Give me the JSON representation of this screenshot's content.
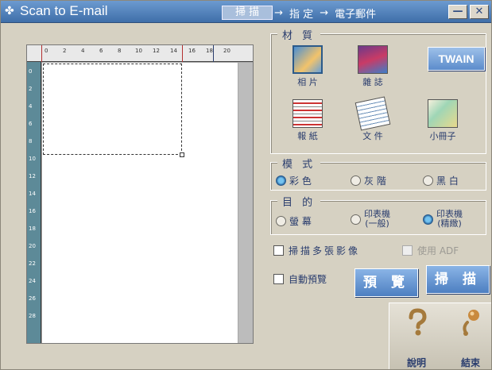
{
  "window": {
    "title": "Scan to E-mail",
    "icon": "scanner-icon"
  },
  "steps": {
    "step1": "掃 描",
    "step2": "指 定",
    "step3": "電子郵件",
    "arrow": "→"
  },
  "title_buttons": {
    "minimize": "—",
    "close": "✕"
  },
  "ruler": {
    "top_ticks": [
      "0",
      "2",
      "4",
      "6",
      "8",
      "10",
      "12",
      "14",
      "16",
      "18",
      "20"
    ],
    "left_ticks": [
      "0",
      "2",
      "4",
      "6",
      "8",
      "10",
      "12",
      "14",
      "16",
      "18",
      "20",
      "22",
      "24",
      "26",
      "28"
    ]
  },
  "material": {
    "title": "材 質",
    "items": [
      {
        "label": "相 片",
        "selected": true,
        "icon": "photo-icon"
      },
      {
        "label": "雜 誌",
        "selected": false,
        "icon": "magazine-icon"
      },
      {
        "label": "報 紙",
        "selected": false,
        "icon": "newspaper-icon"
      },
      {
        "label": "文 件",
        "selected": false,
        "icon": "document-icon"
      },
      {
        "label": "小冊子",
        "selected": false,
        "icon": "booklet-icon"
      }
    ]
  },
  "twain_label": "TWAIN",
  "mode": {
    "title": "模 式",
    "options": [
      {
        "label": "彩 色",
        "selected": true
      },
      {
        "label": "灰 階",
        "selected": false
      },
      {
        "label": "黑 白",
        "selected": false
      }
    ]
  },
  "purpose": {
    "title": "目 的",
    "options": [
      {
        "label": "螢 幕",
        "selected": false
      },
      {
        "label_line1": "印表機",
        "label_line2": "(一般)",
        "selected": false
      },
      {
        "label_line1": "印表機",
        "label_line2": "(精緻)",
        "selected": true
      }
    ]
  },
  "checks": {
    "multi_scan": "掃描多張影像",
    "adf": "使用 ADF",
    "auto_preview": "自動預覽"
  },
  "buttons": {
    "preview": "預 覽",
    "scan": "掃 描"
  },
  "help": {
    "help_label": "說明",
    "exit_label": "結束"
  },
  "colors": {
    "title_bar": "#4f7fb9",
    "accent_button": "#6b9ad4",
    "panel": "#d6d1c2"
  }
}
